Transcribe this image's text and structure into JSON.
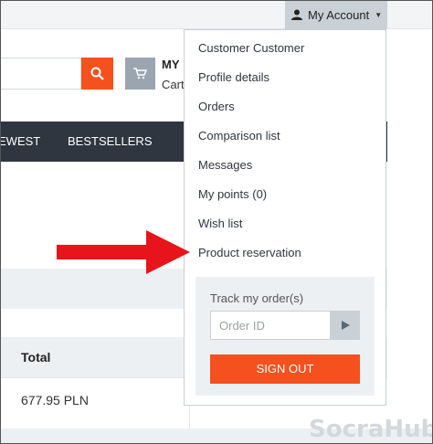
{
  "topbar": {
    "account_label": "My Account"
  },
  "header": {
    "cart_title": "MY",
    "cart_sub": "Cart"
  },
  "nav": {
    "items": [
      "EWEST",
      "BESTSELLERS"
    ]
  },
  "dropdown": {
    "items": [
      "Customer Customer",
      "Profile details",
      "Orders",
      "Comparison list",
      "Messages",
      "My points (0)",
      "Wish list",
      "Product reservation"
    ],
    "track_label": "Track my order(s)",
    "order_placeholder": "Order ID",
    "signout_label": "SIGN OUT"
  },
  "table": {
    "header_total": "Total",
    "cell_total": "677.95 PLN"
  },
  "annotation": {
    "arrow_color": "#e8141b"
  },
  "watermark": {
    "text": "SocraHub"
  },
  "colors": {
    "accent": "#f4511e",
    "nav_bg": "#2f3640",
    "account_bg": "#c9d0d6"
  }
}
